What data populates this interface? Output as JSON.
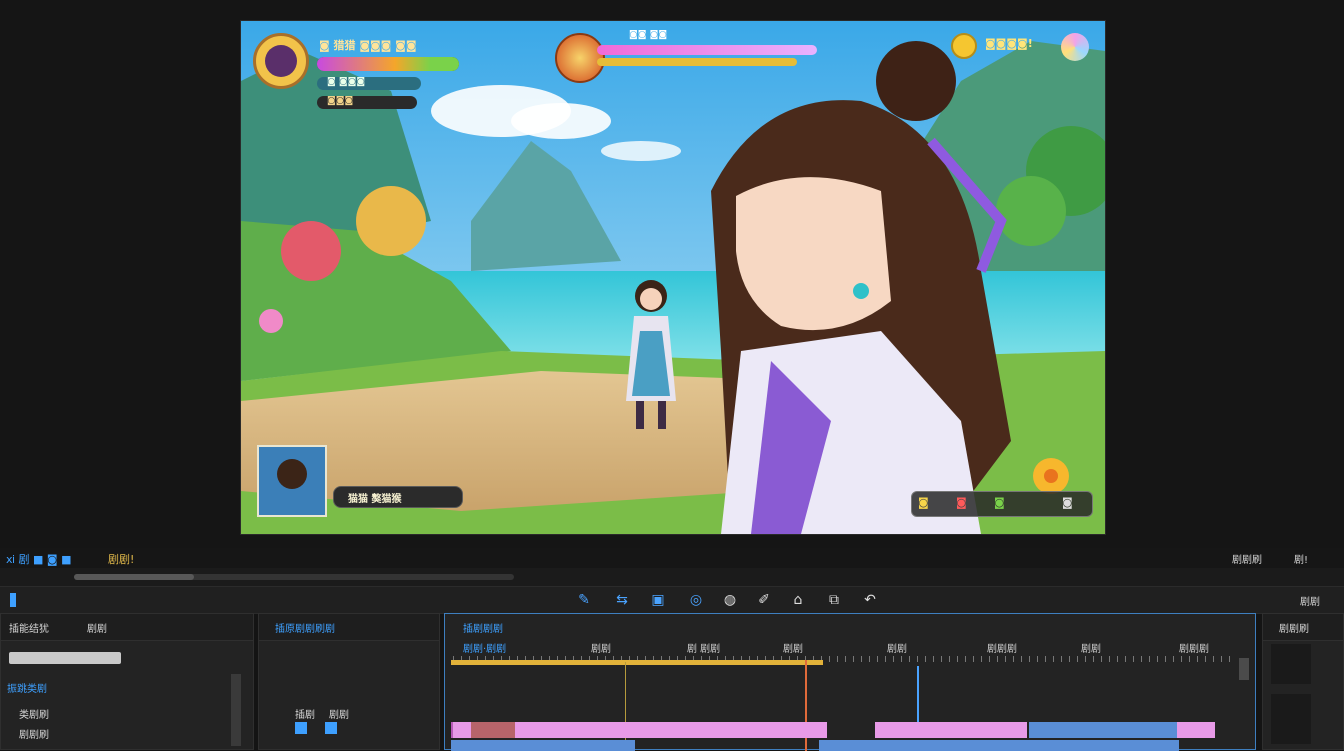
{
  "game_hud": {
    "player_name": "◙ 猎猎 ◙◙◙ ◙◙",
    "health_text": "◙◙◙",
    "mana_text": "◙ ◙◙◙",
    "boss_name": "◙◙ ◙◙",
    "top_right_text": "◙◙◙◙!",
    "dialog_text": "猫猫 獒猫猴",
    "bottom_right_icons": [
      "◙",
      "◙",
      "◙",
      "◙"
    ]
  },
  "top_toolbar": {
    "left_text": "ⅺ 剧 ■ ◙ ■",
    "label_2": "剧剧!",
    "right_text_1": "剧剧刷",
    "right_text_2": "剧!"
  },
  "tools": [
    "✎",
    "⇆",
    "▣",
    "◎",
    "◍",
    "✐",
    "⌂",
    "⧉",
    "↶"
  ],
  "right_tool_label": "剧剧",
  "left_panel": {
    "title": "插能结犹",
    "tab2": "剧剧",
    "section_label": "振跳类剧",
    "row1": "类剧刷",
    "row2": "剧剧刷"
  },
  "mid_panel": {
    "title": "插原剧剧刷剧",
    "footer_left": "插剧",
    "footer_right": "剧剧"
  },
  "timeline": {
    "title": "插剧剧剧",
    "timecode": "剧剧·剧剧",
    "ruler": [
      "剧剧",
      "剧 剧剧",
      "剧剧",
      "剧剧",
      "剧剧剧",
      "剧剧",
      "剧剧剧"
    ]
  },
  "right_panel": {
    "title": "剧剧刷"
  },
  "colors": {
    "accent": "#3ea0ff",
    "playhead": "#e06a3a",
    "work_area": "#e2b23a",
    "clip_pink": "#e89ae8",
    "clip_blue": "#5a8ed6"
  }
}
